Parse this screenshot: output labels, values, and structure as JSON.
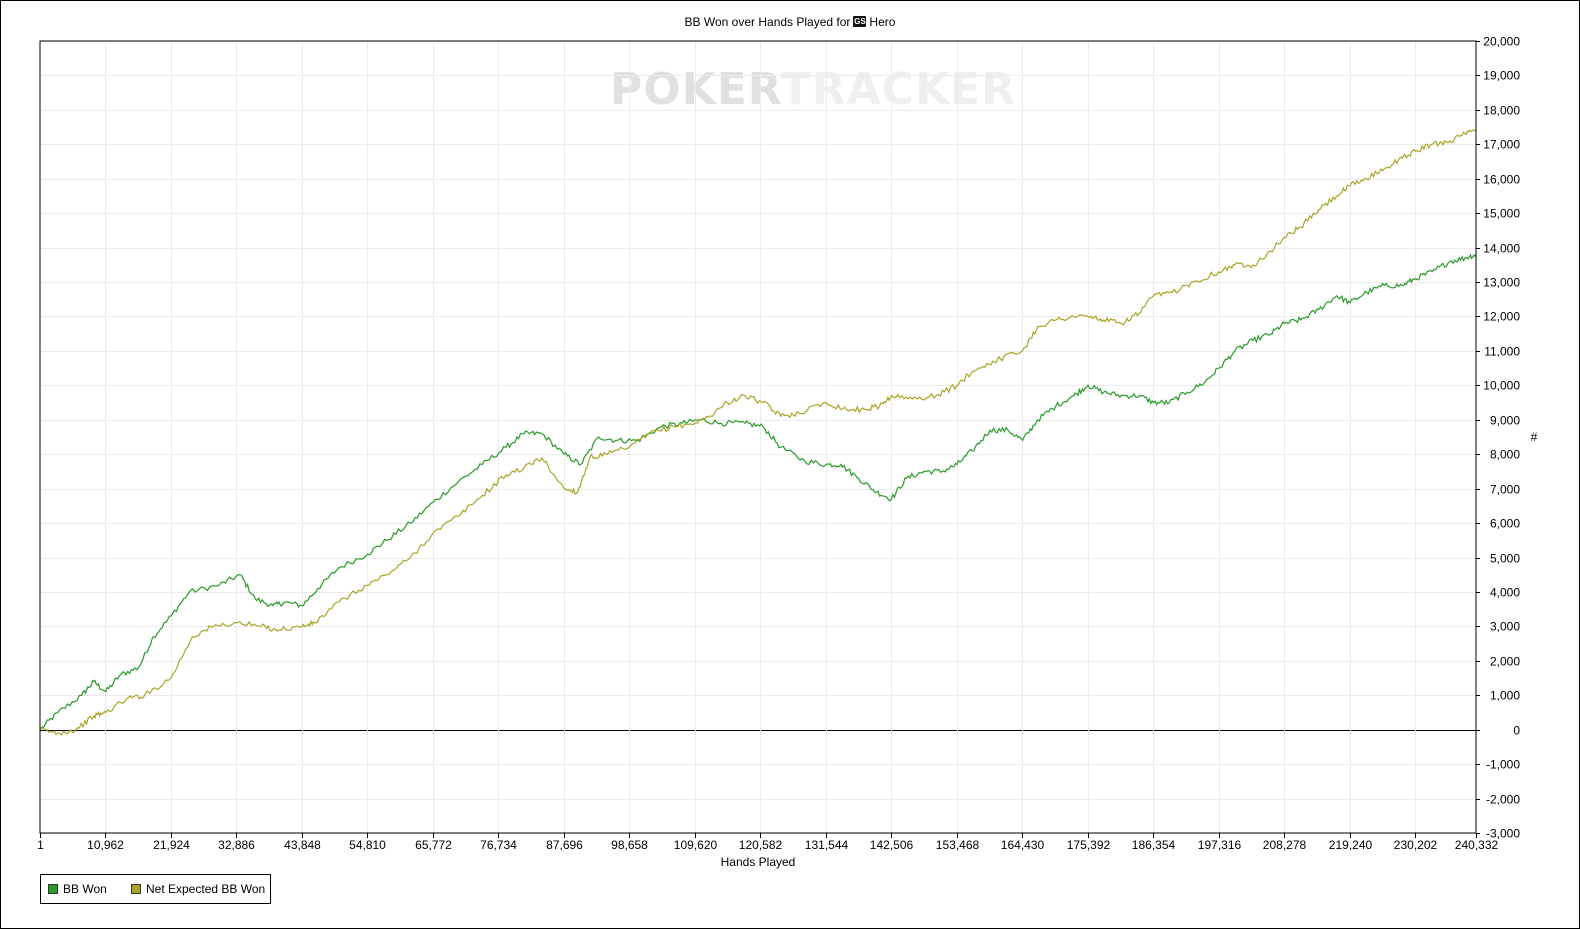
{
  "title": {
    "text": "BB Won over Hands Played for",
    "site_icon": "poker-site-icon",
    "site_icon_text": "GS",
    "player": "Hero"
  },
  "watermark": {
    "bold": "POKER",
    "light": "TRACKER"
  },
  "colors": {
    "bb_won": "#2a9a2a",
    "net_expected": "#a8a628",
    "grid": "#ebebeb",
    "zero_line": "#000000"
  },
  "chart_data": {
    "type": "line",
    "title": "BB Won over Hands Played for Hero",
    "xlabel": "Hands Played",
    "ylabel": "#",
    "xlim": [
      1,
      240332
    ],
    "ylim": [
      -3000,
      20000
    ],
    "x_ticks": [
      "1",
      "10,962",
      "21,924",
      "32,886",
      "43,848",
      "54,810",
      "65,772",
      "76,734",
      "87,696",
      "98,658",
      "109,620",
      "120,582",
      "131,544",
      "142,506",
      "153,468",
      "164,430",
      "175,392",
      "186,354",
      "197,316",
      "208,278",
      "219,240",
      "230,202",
      "240,332"
    ],
    "y_ticks": [
      "20,000",
      "19,000",
      "18,000",
      "17,000",
      "16,000",
      "15,000",
      "14,000",
      "13,000",
      "12,000",
      "11,000",
      "10,000",
      "9,000",
      "8,000",
      "7,000",
      "6,000",
      "5,000",
      "4,000",
      "3,000",
      "2,000",
      "1,000",
      "0",
      "-1,000",
      "-2,000",
      "-3,000"
    ],
    "grid": true,
    "legend_position": "bottom-left",
    "series": [
      {
        "name": "BB Won",
        "x": [
          1,
          3000,
          7000,
          9000,
          11000,
          13500,
          16500,
          19000,
          21924,
          25000,
          30000,
          33500,
          36000,
          39000,
          41000,
          43848,
          46500,
          50000,
          54810,
          58000,
          62000,
          65772,
          70000,
          74000,
          78000,
          81000,
          84000,
          87696,
          90500,
          93500,
          96500,
          100000,
          104000,
          107500,
          110500,
          114000,
          118000,
          121000,
          124000,
          128000,
          131544,
          134000,
          137000,
          140000,
          142506,
          145000,
          148000,
          151000,
          153468,
          156000,
          159000,
          162000,
          164430,
          167000,
          170000,
          173000,
          175392,
          178000,
          181000,
          184000,
          186354,
          189000,
          192000,
          195000,
          197316,
          200000,
          203000,
          206000,
          208278,
          211000,
          214000,
          217000,
          219240,
          222000,
          225000,
          228000,
          230202,
          233000,
          236000,
          238500,
          240332
        ],
        "y": [
          0,
          500,
          1000,
          1400,
          1100,
          1600,
          1800,
          2700,
          3300,
          4000,
          4200,
          4500,
          3800,
          3600,
          3700,
          3600,
          4100,
          4700,
          5100,
          5500,
          6000,
          6600,
          7200,
          7700,
          8200,
          8600,
          8600,
          8000,
          7700,
          8500,
          8400,
          8400,
          8800,
          8900,
          9000,
          8900,
          8900,
          8800,
          8200,
          7800,
          7700,
          7700,
          7300,
          6900,
          6700,
          7300,
          7500,
          7500,
          7700,
          8100,
          8700,
          8700,
          8400,
          9000,
          9400,
          9700,
          10000,
          9800,
          9700,
          9700,
          9500,
          9500,
          9800,
          10100,
          10500,
          11000,
          11300,
          11500,
          11800,
          11900,
          12200,
          12600,
          12400,
          12700,
          12900,
          12900,
          13100,
          13300,
          13600,
          13700,
          13800
        ]
      },
      {
        "name": "Net Expected BB Won",
        "x": [
          1,
          3000,
          6000,
          9000,
          11000,
          14500,
          17500,
          21924,
          25500,
          29000,
          33000,
          37000,
          40000,
          43848,
          46000,
          50000,
          54810,
          58000,
          62000,
          65772,
          70000,
          74000,
          78000,
          81000,
          84000,
          87696,
          90000,
          92000,
          95000,
          98658,
          102000,
          106000,
          109620,
          112000,
          115000,
          118000,
          121000,
          124000,
          127000,
          131544,
          135000,
          138000,
          140500,
          142506,
          146000,
          150000,
          153468,
          156000,
          159500,
          164430,
          167000,
          170000,
          173000,
          175392,
          178000,
          181000,
          184000,
          186354,
          189500,
          193000,
          197316,
          200000,
          203000,
          206000,
          208278,
          211000,
          214000,
          217000,
          219240,
          222000,
          225000,
          228000,
          230202,
          233000,
          236000,
          238500,
          240332
        ],
        "y": [
          0,
          -100,
          0,
          400,
          500,
          900,
          1000,
          1500,
          2700,
          3000,
          3100,
          3000,
          2900,
          3000,
          3100,
          3700,
          4200,
          4500,
          5000,
          5700,
          6200,
          6800,
          7400,
          7600,
          7900,
          7000,
          6900,
          7900,
          8000,
          8200,
          8600,
          8800,
          8900,
          9100,
          9500,
          9700,
          9500,
          9100,
          9200,
          9500,
          9300,
          9300,
          9400,
          9700,
          9600,
          9700,
          10000,
          10400,
          10700,
          11000,
          11700,
          11900,
          12000,
          12000,
          11900,
          11800,
          12100,
          12600,
          12700,
          13000,
          13300,
          13500,
          13500,
          13900,
          14300,
          14600,
          15100,
          15500,
          15800,
          16000,
          16300,
          16600,
          16800,
          17000,
          17100,
          17300,
          17400
        ]
      }
    ]
  }
}
